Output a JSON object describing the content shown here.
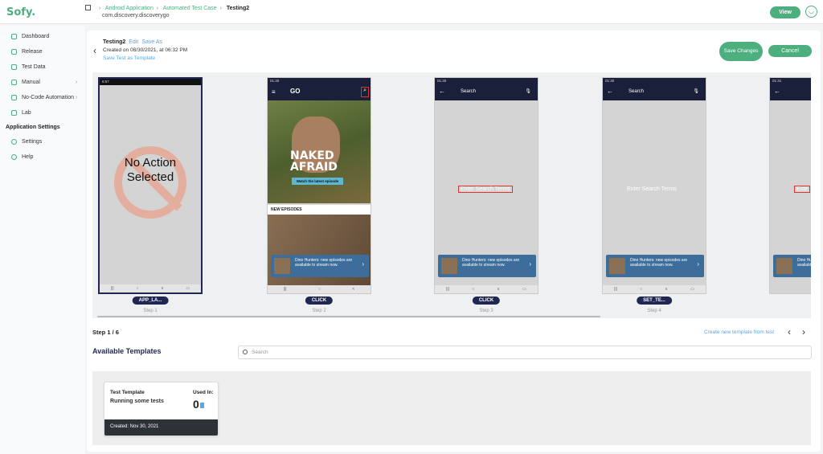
{
  "app": {
    "logo": "Sofy."
  },
  "breadcrumb": {
    "items": [
      "Android Application",
      "Automated Test Case",
      "Testing2"
    ],
    "package": "com.discovery.discoverygo"
  },
  "header": {
    "view_label": "View"
  },
  "sidebar": {
    "items": [
      {
        "label": "Dashboard"
      },
      {
        "label": "Release"
      },
      {
        "label": "Test Data"
      },
      {
        "label": "Manual"
      },
      {
        "label": "No-Code Automation"
      },
      {
        "label": "Lab"
      }
    ],
    "section": "Application Settings",
    "settings": [
      {
        "label": "Settings"
      },
      {
        "label": "Help"
      }
    ]
  },
  "test": {
    "name": "Testing2",
    "edit": "Edit",
    "save_as": "Save As",
    "created": "Created on 08/30/2021, at 06:32 PM",
    "save_template": "Save Test as Template",
    "save_changes": "Save Changes",
    "cancel": "Cancel"
  },
  "steps": [
    {
      "badge": "APP_LA...",
      "label": "Step 1",
      "status_time": "6:57",
      "noaction": "No Action Selected"
    },
    {
      "badge": "CLICK",
      "label": "Step 2",
      "status_time": "01:30",
      "hero_title": "NAKED AFRAID",
      "hero_btn": "Watch the latest episode",
      "new_eps": "NEW EPISODES",
      "notif": "Dino Hunters: new episodes are available to stream now."
    },
    {
      "badge": "CLICK",
      "label": "Step 3",
      "status_time": "01:30",
      "search": "Search",
      "placeholder": "Enter Search Terms",
      "notif": "Dino Hunters: new episodes are available to stream now."
    },
    {
      "badge": "SET_TE...",
      "label": "Step 4",
      "status_time": "01:30",
      "search": "Search",
      "placeholder": "Enter Search Terms",
      "notif": "Dino Hunters: new episodes are available to stream now."
    },
    {
      "status_time": "01:31",
      "placeholder": "Ente",
      "notif": "Dino Hunters: new episodes are available to stream now."
    }
  ],
  "pager": {
    "step_text": "Step 1 / 6",
    "create_link": "Create new template from test"
  },
  "templates": {
    "heading": "Available Templates",
    "search_placeholder": "Search",
    "card": {
      "title": "Test Template",
      "desc": "Running some tests",
      "used_in": "Used In:",
      "count": "0",
      "created": "Created: Nov 30, 2021"
    }
  },
  "colors": {
    "accent": "#4caf7d",
    "navy": "#1f2752",
    "link": "#5aa6e8"
  }
}
